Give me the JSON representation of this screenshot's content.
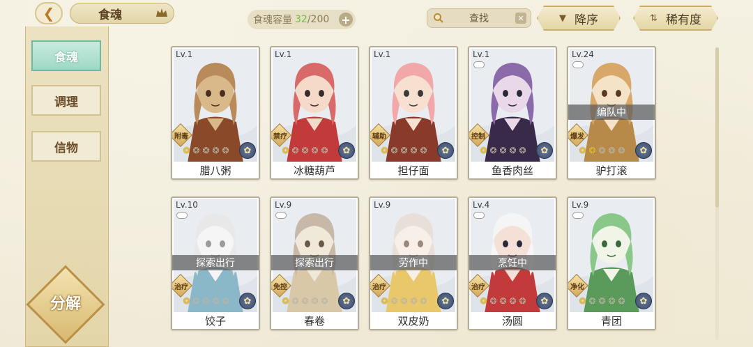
{
  "header": {
    "back_icon": "back-arrow-icon",
    "title": "食魂",
    "crown_icon": "crown-icon",
    "capacity_label": "食魂容量",
    "capacity_current": "32",
    "capacity_max": "/200",
    "capacity_plus": "+",
    "search_placeholder": "查找",
    "search_clear": "✕",
    "sort_desc_label": "降序",
    "sort_rarity_label": "稀有度"
  },
  "sidebar": {
    "tabs": [
      {
        "label": "食魂",
        "active": true
      },
      {
        "label": "调理",
        "active": false
      },
      {
        "label": "信物",
        "active": false
      }
    ],
    "decompose_label": "分解"
  },
  "cards": [
    {
      "level": "Lv.1",
      "name": "腊八粥",
      "role": "附毒",
      "status": "",
      "stars": 1,
      "locked": false,
      "colors": [
        "#b98a5a",
        "#4a3020",
        "#d9b98a",
        "#8a4a2a"
      ]
    },
    {
      "level": "Lv.1",
      "name": "冰糖葫芦",
      "role": "禁疗",
      "status": "",
      "stars": 1,
      "locked": false,
      "colors": [
        "#d86a6a",
        "#3a2a2a",
        "#f5d9c9",
        "#c23a3a"
      ]
    },
    {
      "level": "Lv.1",
      "name": "担仔面",
      "role": "辅助",
      "status": "",
      "stars": 1,
      "locked": false,
      "colors": [
        "#f2a8a8",
        "#3a3a3a",
        "#f7e0d0",
        "#8a3a2a"
      ]
    },
    {
      "level": "Lv.1",
      "name": "鱼香肉丝",
      "role": "控制",
      "status": "",
      "stars": 1,
      "locked": true,
      "colors": [
        "#8a6aa8",
        "#2a2a3a",
        "#e8d8e8",
        "#3a2a4a"
      ]
    },
    {
      "level": "Lv.24",
      "name": "驴打滚",
      "role": "爆发",
      "status": "编队中",
      "stars": 2,
      "locked": true,
      "colors": [
        "#d8a86a",
        "#5a3a20",
        "#f5e3c8",
        "#b88a4a"
      ]
    },
    {
      "level": "Lv.10",
      "name": "饺子",
      "role": "治疗",
      "status": "探索出行",
      "stars": 1,
      "locked": true,
      "colors": [
        "#e8e8e8",
        "#9a9a9a",
        "#f5f5f5",
        "#8ab8c8"
      ]
    },
    {
      "level": "Lv.9",
      "name": "春卷",
      "role": "免控",
      "status": "探索出行",
      "stars": 1,
      "locked": true,
      "colors": [
        "#c8b8a8",
        "#6a5a4a",
        "#f0e8d8",
        "#d8c8a8"
      ]
    },
    {
      "level": "Lv.9",
      "name": "双皮奶",
      "role": "治疗",
      "status": "劳作中",
      "stars": 1,
      "locked": false,
      "colors": [
        "#e8e0d8",
        "#9a8a7a",
        "#f8f0e8",
        "#e8c86a"
      ]
    },
    {
      "level": "Lv.4",
      "name": "汤圆",
      "role": "治疗",
      "status": "烹饪中",
      "stars": 1,
      "locked": true,
      "colors": [
        "#f5f5f5",
        "#2a2a3a",
        "#f5e0d8",
        "#c23a3a"
      ]
    },
    {
      "level": "Lv.9",
      "name": "青团",
      "role": "净化",
      "status": "",
      "stars": 1,
      "locked": true,
      "colors": [
        "#8ac88a",
        "#3a6a3a",
        "#f0f5e8",
        "#5a9a5a"
      ]
    }
  ],
  "element_icon": "flower-element-icon",
  "lock_icon": "lock-pill-icon"
}
